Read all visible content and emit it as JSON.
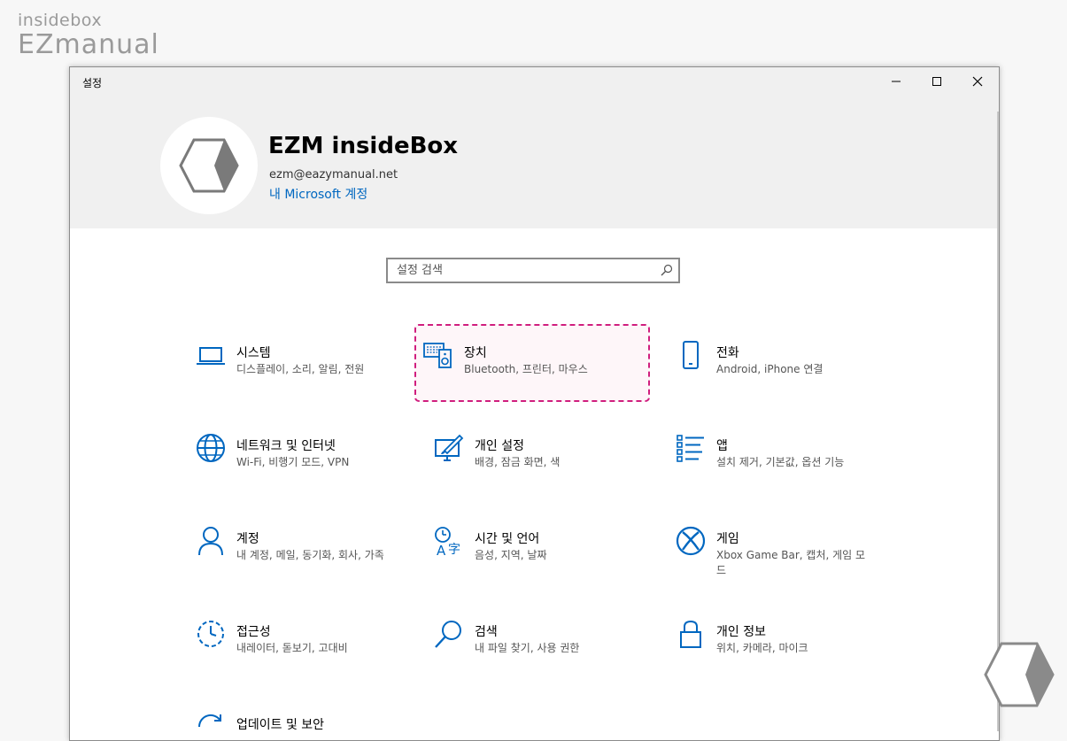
{
  "watermark": {
    "line1": "insidebox",
    "line2": "EZmanual"
  },
  "window": {
    "title": "설정",
    "controls": {
      "minimize_icon": "minimize-icon",
      "maximize_icon": "maximize-icon",
      "close_icon": "close-icon"
    }
  },
  "header": {
    "user_name": "EZM insideBox",
    "email": "ezm@eazymanual.net",
    "account_link": "내 Microsoft 계정"
  },
  "search": {
    "placeholder": "설정 검색",
    "icon": "search-icon"
  },
  "accent_color": "#0067c0",
  "highlight_color": "#d01e7e",
  "tiles": [
    {
      "title": "시스템",
      "desc": "디스플레이, 소리, 알림, 전원",
      "icon": "laptop-icon"
    },
    {
      "title": "장치",
      "desc": "Bluetooth, 프린터, 마우스",
      "icon": "devices-icon",
      "highlighted": true
    },
    {
      "title": "전화",
      "desc": "Android, iPhone 연결",
      "icon": "phone-icon"
    },
    {
      "title": "네트워크 및 인터넷",
      "desc": "Wi-Fi, 비행기 모드, VPN",
      "icon": "globe-icon"
    },
    {
      "title": "개인 설정",
      "desc": "배경, 잠금 화면, 색",
      "icon": "personalization-icon"
    },
    {
      "title": "앱",
      "desc": "설치 제거, 기본값, 옵션 기능",
      "icon": "apps-list-icon"
    },
    {
      "title": "계정",
      "desc": "내 계정, 메일, 동기화, 회사, 가족",
      "icon": "person-icon"
    },
    {
      "title": "시간 및 언어",
      "desc": "음성, 지역, 날짜",
      "icon": "time-language-icon"
    },
    {
      "title": "게임",
      "desc": "Xbox Game Bar, 캡처, 게임 모드",
      "icon": "xbox-icon"
    },
    {
      "title": "접근성",
      "desc": "내레이터, 돋보기, 고대비",
      "icon": "ease-of-access-icon"
    },
    {
      "title": "검색",
      "desc": "내 파일 찾기, 사용 권한",
      "icon": "search-magnifier-icon"
    },
    {
      "title": "개인 정보",
      "desc": "위치, 카메라, 마이크",
      "icon": "lock-icon"
    },
    {
      "title": "업데이트 및 보안",
      "desc": "",
      "icon": "update-icon"
    }
  ]
}
